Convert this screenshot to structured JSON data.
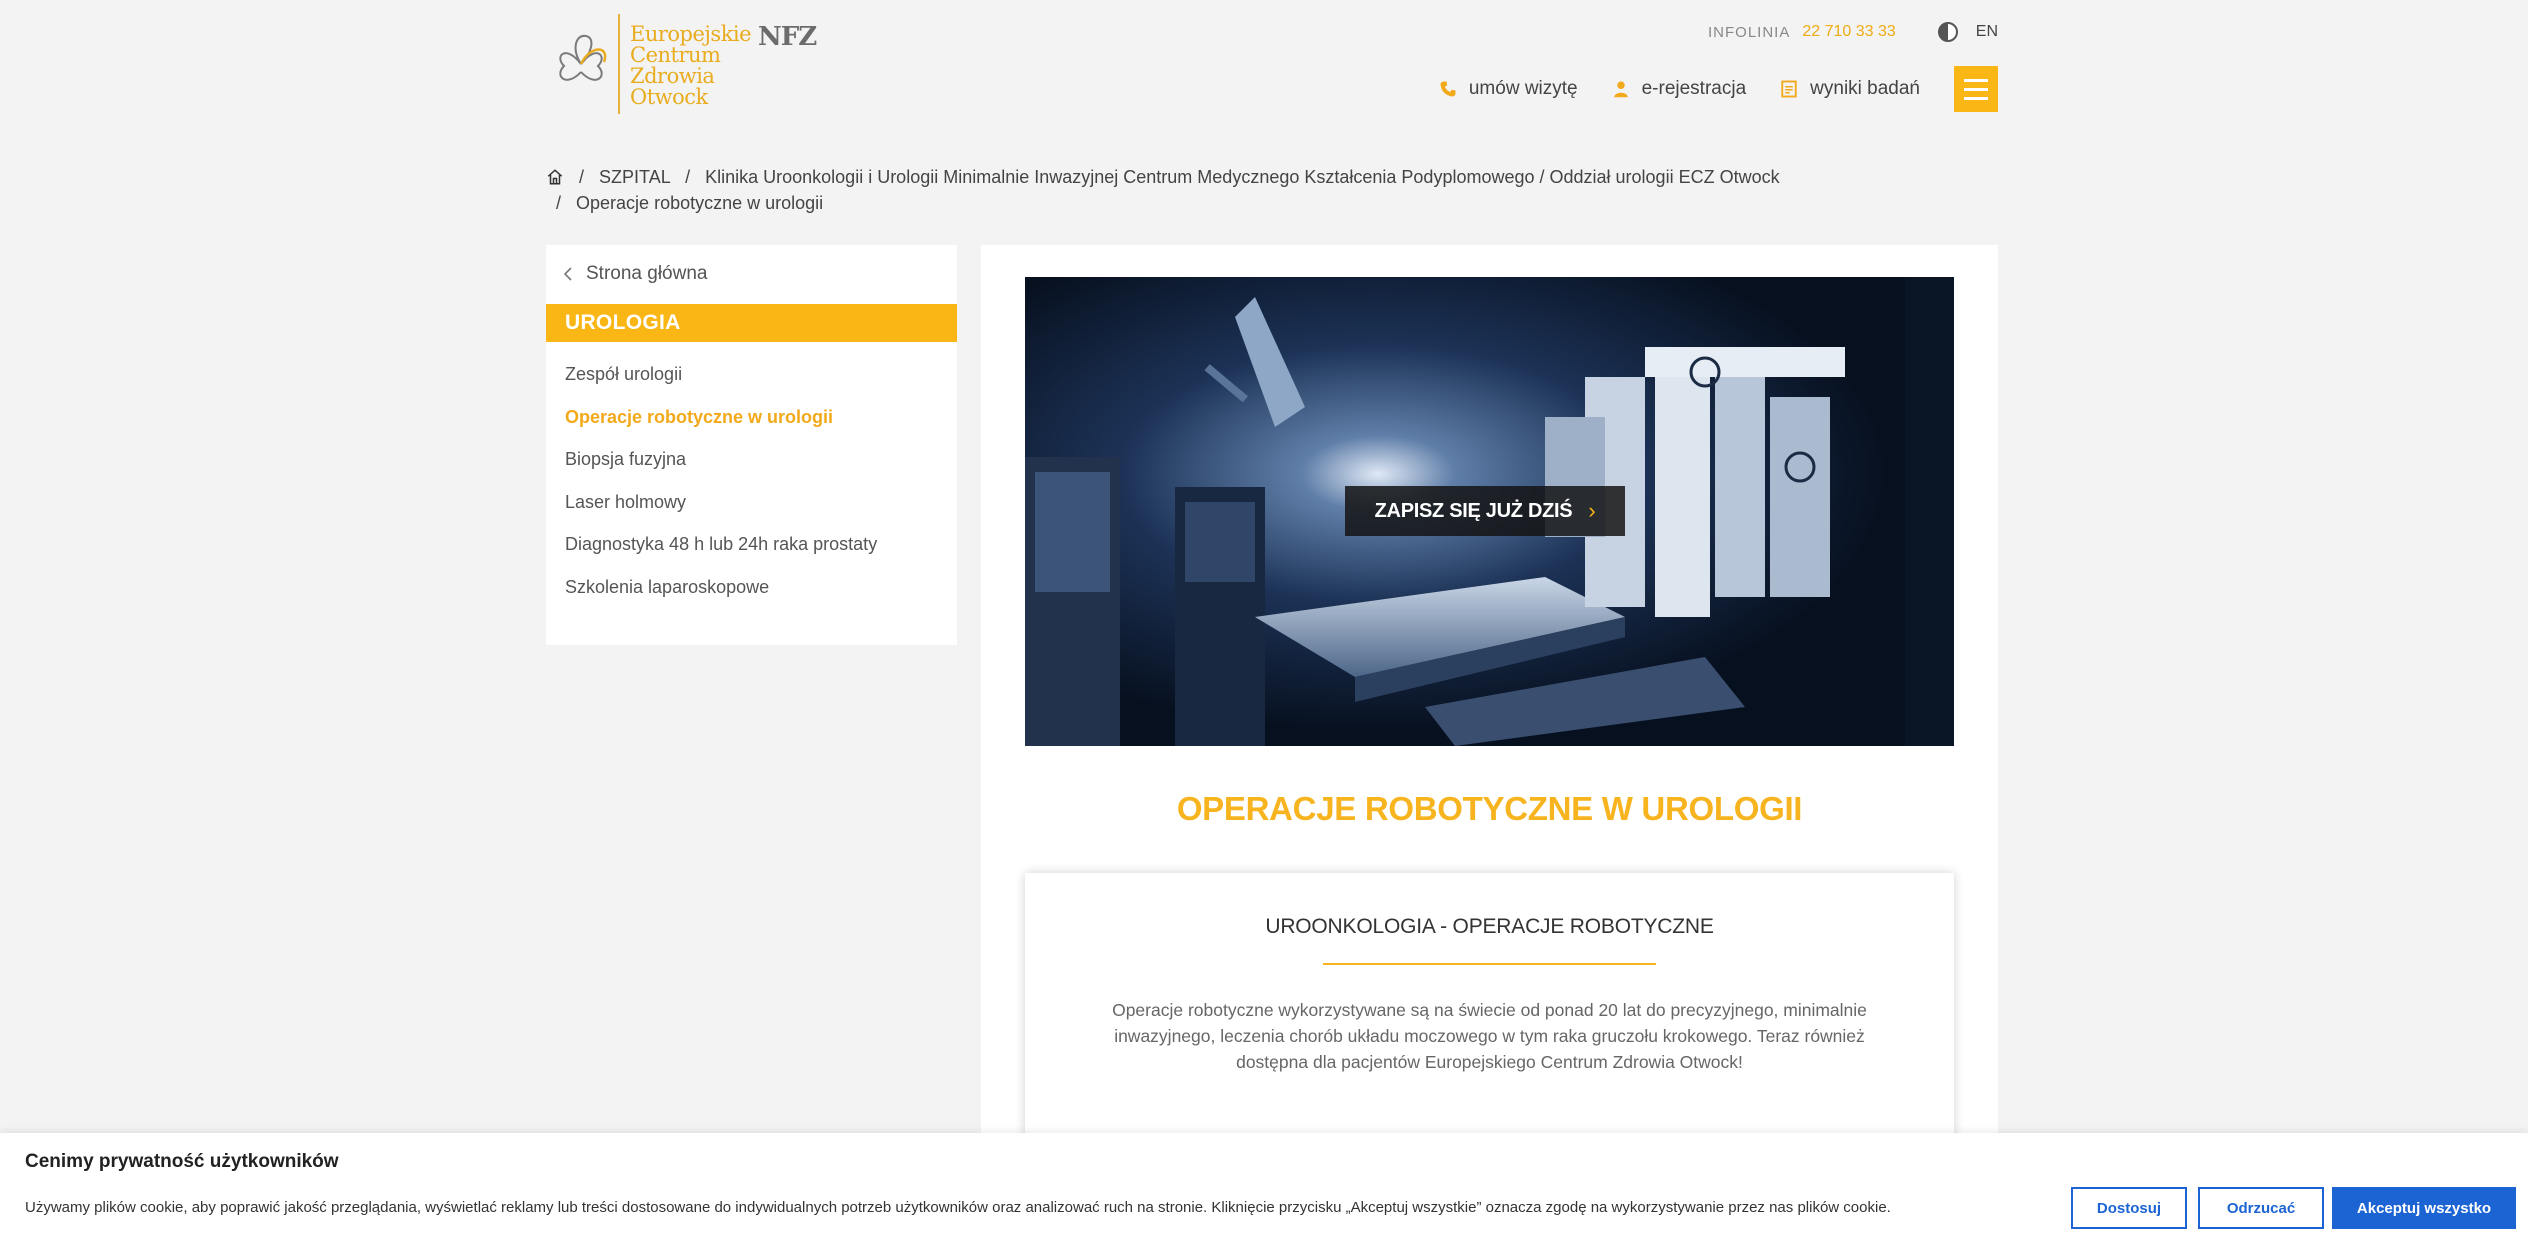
{
  "header": {
    "logo_lines": [
      "Europejskie",
      "Centrum",
      "Zdrowia",
      "Otwock"
    ],
    "nfz": "NFZ",
    "infolinia_label": "INFOLINIA",
    "infolinia_number": "22 710 33 33",
    "lang": "EN",
    "quicknav": [
      {
        "label": "umów wizytę",
        "icon": "phone-icon"
      },
      {
        "label": "e-rejestracja",
        "icon": "user-icon"
      },
      {
        "label": "wyniki badań",
        "icon": "document-icon"
      }
    ]
  },
  "breadcrumb": {
    "items": [
      "SZPITAL",
      "Klinika Uroonkologii i Urologii Minimalnie Inwazyjnej Centrum Medycznego Kształcenia Podyplomowego / Oddział urologii ECZ Otwock",
      "Operacje robotyczne w urologii"
    ]
  },
  "sidebar": {
    "back_label": "Strona główna",
    "heading": "UROLOGIA",
    "items": [
      {
        "label": "Zespół urologii",
        "active": false
      },
      {
        "label": "Operacje robotyczne w urologii",
        "active": true
      },
      {
        "label": "Biopsja fuzyjna",
        "active": false
      },
      {
        "label": "Laser holmowy",
        "active": false
      },
      {
        "label": "Diagnostyka 48 h lub 24h raka prostaty",
        "active": false
      },
      {
        "label": "Szkolenia laparoskopowe",
        "active": false
      }
    ]
  },
  "main": {
    "cta_label": "ZAPISZ SIĘ JUŻ DZIŚ",
    "title": "OPERACJE ROBOTYCZNE W UROLOGII",
    "card": {
      "heading": "UROONKOLOGIA - OPERACJE ROBOTYCZNE",
      "text": "Operacje robotyczne wykorzystywane są na świecie od ponad 20 lat do precyzyjnego, minimalnie inwazyjnego, leczenia chorób układu moczowego w tym raka gruczołu krokowego. Teraz również dostępna dla pacjentów Europejskiego Centrum Zdrowia Otwock!"
    }
  },
  "cookie": {
    "title": "Cenimy prywatność użytkowników",
    "text": "Używamy plików cookie, aby poprawić jakość przeglądania, wyświetlać reklamy lub treści dostosowane do indywidualnych potrzeb użytkowników oraz analizować ruch na stronie. Kliknięcie przycisku „Akceptuj wszystkie” oznacza zgodę na wykorzystywanie przez nas plików cookie.",
    "btn_customize": "Dostosuj",
    "btn_reject": "Odrzucać",
    "btn_accept": "Akceptuj wszystko"
  },
  "colors": {
    "accent": "#f9b614",
    "cookie_blue": "#1c64d4"
  }
}
